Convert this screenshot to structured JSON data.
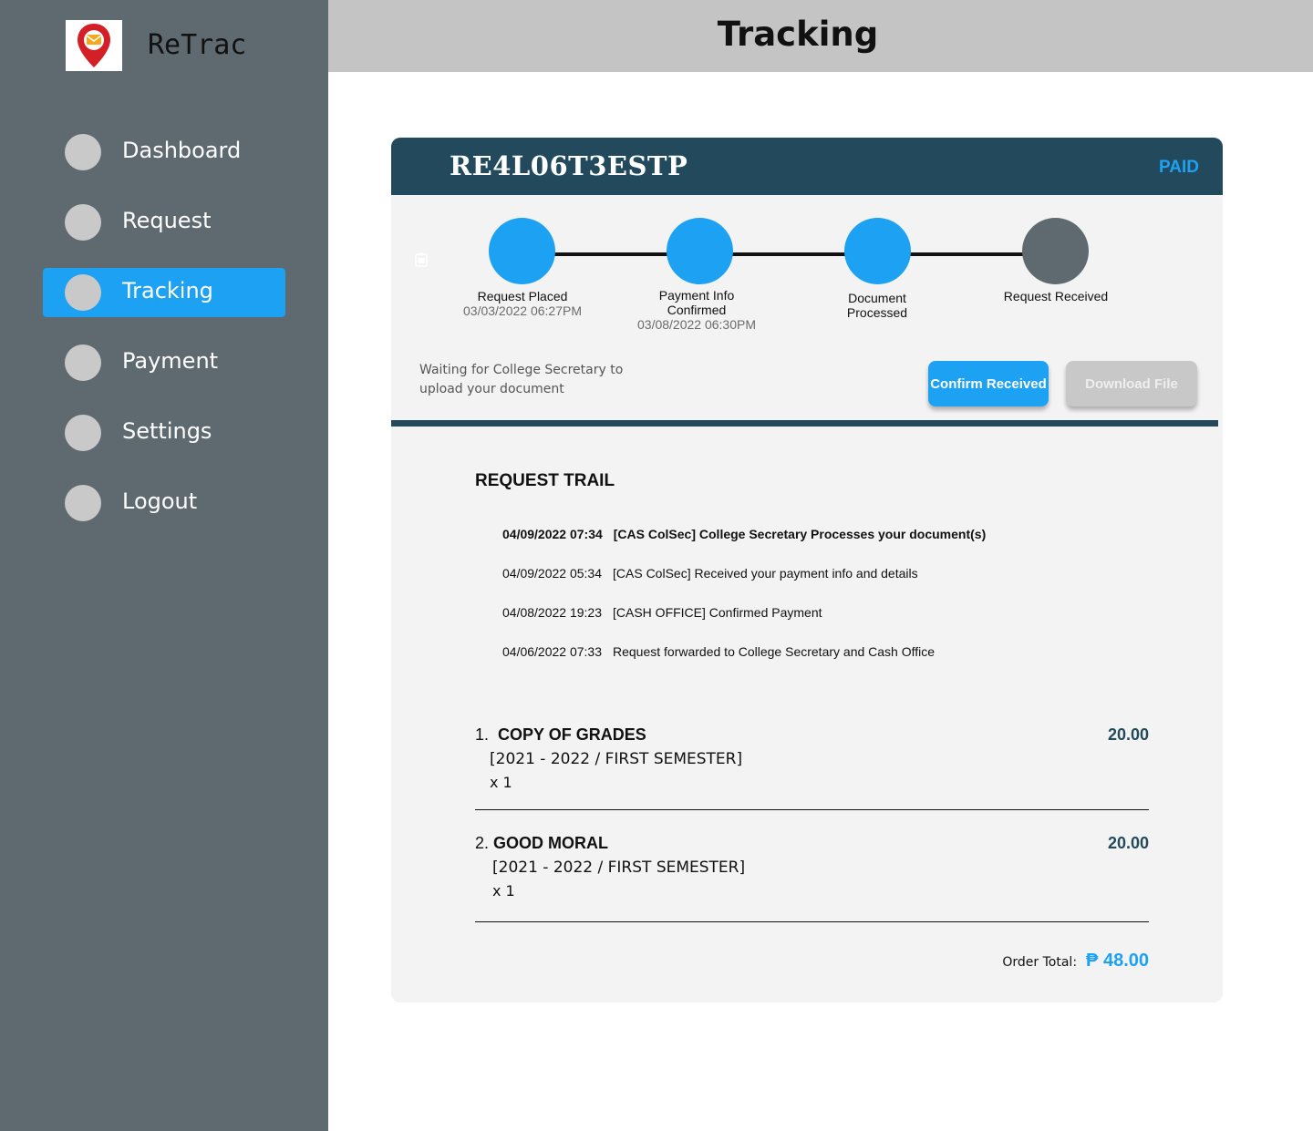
{
  "colors": {
    "sidebar_bg": "#5f6a70",
    "accent": "#1da1f2",
    "header_dark": "#234a5c",
    "topbar_bg": "#c4c4c4",
    "card_bg": "#f3f3f3",
    "pending_step": "#5f6a70",
    "disabled_button": "#c8c8c8"
  },
  "app": {
    "name": "ReTrac",
    "logo_icon": "location-pin-mail-icon"
  },
  "sidebar": {
    "items": [
      {
        "label": "Dashboard",
        "active": false
      },
      {
        "label": "Request",
        "active": false
      },
      {
        "label": "Tracking",
        "active": true
      },
      {
        "label": "Payment",
        "active": false
      },
      {
        "label": "Settings",
        "active": false
      },
      {
        "label": "Logout",
        "active": false
      }
    ]
  },
  "header": {
    "title": "Tracking"
  },
  "request": {
    "reference": "RE4L06T3ESTP",
    "payment_status": "PAID",
    "steps": [
      {
        "label": "Request Placed",
        "date": "03/03/2022 06:27PM",
        "done": true
      },
      {
        "label": "Payment Info\nConfirmed",
        "date": "03/08/2022 06:30PM",
        "done": true
      },
      {
        "label": "Document\nProcessed",
        "date": "",
        "done": true
      },
      {
        "label": "Request Received",
        "date": "",
        "done": false
      }
    ],
    "waiting_message": "Waiting for College Secretary to upload your document",
    "confirm_button": "Confirm Received",
    "download_button": "Download File"
  },
  "trail": {
    "title": "REQUEST TRAIL",
    "entries": [
      {
        "date": "04/09/2022 07:34",
        "text": "[CAS ColSec] College Secretary Processes your document(s)",
        "bold": true
      },
      {
        "date": "04/09/2022 05:34",
        "text": "[CAS ColSec] Received your payment info and details",
        "bold": false
      },
      {
        "date": "04/08/2022 19:23",
        "text": "[CASH OFFICE] Confirmed Payment",
        "bold": false
      },
      {
        "date": "04/06/2022 07:33",
        "text": "Request forwarded to College Secretary and Cash Office",
        "bold": false
      }
    ]
  },
  "items": [
    {
      "number": "1.",
      "name": "COPY OF GRADES",
      "term": "[2021 - 2022 / FIRST SEMESTER]",
      "qty": "x 1",
      "price": "20.00"
    },
    {
      "number": "2.",
      "name": "GOOD MORAL",
      "term": "[2021 - 2022 / FIRST SEMESTER]",
      "qty": "x 1",
      "price": "20.00"
    }
  ],
  "order": {
    "total_label": "Order Total:",
    "total_value": "₱ 48.00"
  }
}
